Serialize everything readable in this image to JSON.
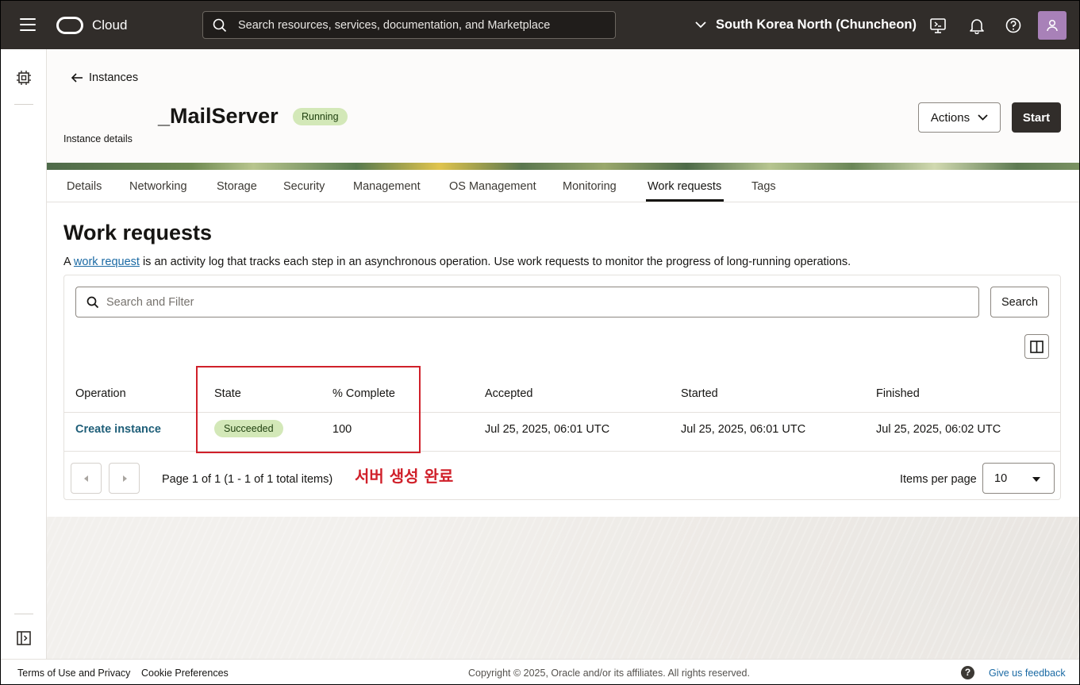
{
  "topbar": {
    "logo_text": "Cloud",
    "search_placeholder": "Search resources, services, documentation, and Marketplace",
    "region": "South Korea North (Chuncheon)"
  },
  "header": {
    "back_label": "Instances",
    "title": "_MailServer",
    "status": "Running",
    "subtitle": "Instance details",
    "actions_label": "Actions",
    "start_label": "Start"
  },
  "tabs": [
    {
      "label": "Details"
    },
    {
      "label": "Networking"
    },
    {
      "label": "Storage"
    },
    {
      "label": "Security"
    },
    {
      "label": "Management"
    },
    {
      "label": "OS Management"
    },
    {
      "label": "Monitoring"
    },
    {
      "label": "Work requests"
    },
    {
      "label": "Tags"
    }
  ],
  "work_requests": {
    "heading": "Work requests",
    "desc_prefix": "A ",
    "desc_link": "work request",
    "desc_suffix": " is an activity log that tracks each step in an asynchronous operation. Use work requests to monitor the progress of long-running operations.",
    "filter_placeholder": "Search and Filter",
    "search_button": "Search",
    "columns": [
      "Operation",
      "State",
      "% Complete",
      "Accepted",
      "Started",
      "Finished"
    ],
    "rows": [
      {
        "operation": "Create instance",
        "state": "Succeeded",
        "percent": "100",
        "accepted": "Jul 25, 2025, 06:01 UTC",
        "started": "Jul 25, 2025, 06:01 UTC",
        "finished": "Jul 25, 2025, 06:02 UTC"
      }
    ],
    "pagination_text": "Page 1 of 1 (1 - 1 of 1 total items)",
    "items_per_page_label": "Items per page",
    "items_per_page_value": "10"
  },
  "annotation": {
    "text": "서버 생성 완료",
    "color": "#d0202a"
  },
  "footer": {
    "terms": "Terms of Use and Privacy",
    "cookies": "Cookie Preferences",
    "copyright": "Copyright © 2025, Oracle and/or its affiliates. All rights reserved.",
    "help_glyph": "?",
    "feedback": "Give us feedback"
  },
  "colors": {
    "topbar": "#312d2a",
    "success_badge": "#d3e8b8",
    "link": "#1b6aa4"
  }
}
